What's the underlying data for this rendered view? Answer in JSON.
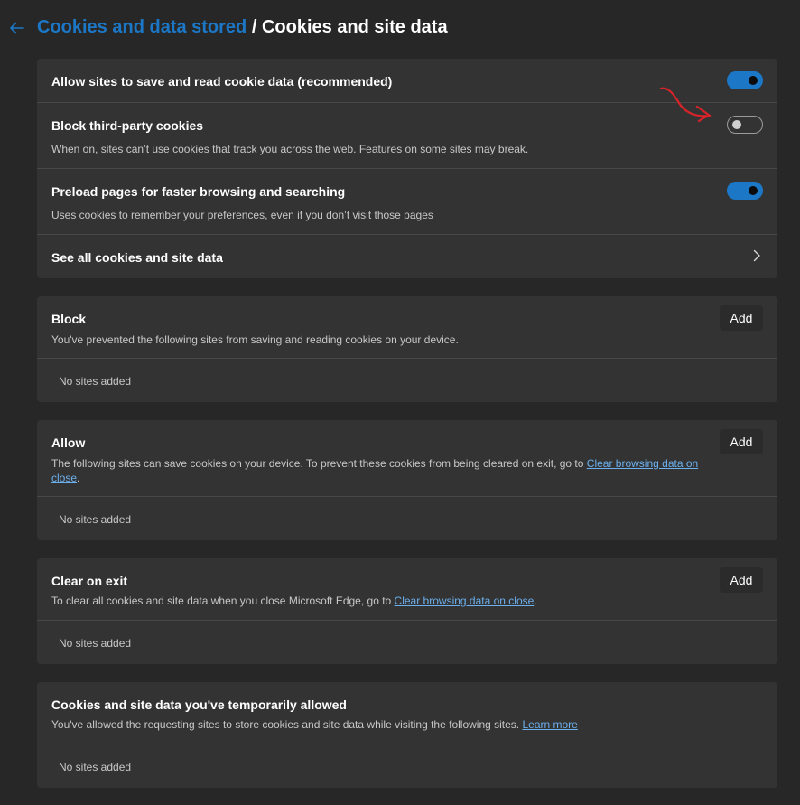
{
  "header": {
    "breadcrumb_parent": "Cookies and data stored",
    "separator": " / ",
    "breadcrumb_current": "Cookies and site data"
  },
  "settings": {
    "allow_sites": {
      "title": "Allow sites to save and read cookie data (recommended)",
      "enabled": true
    },
    "block_third_party": {
      "title": "Block third-party cookies",
      "description": "When on, sites can’t use cookies that track you across the web. Features on some sites may break.",
      "enabled": false
    },
    "preload": {
      "title": "Preload pages for faster browsing and searching",
      "description": "Uses cookies to remember your preferences, even if you don’t visit those pages",
      "enabled": true
    },
    "see_all": {
      "title": "See all cookies and site data"
    }
  },
  "block_section": {
    "title": "Block",
    "description": "You've prevented the following sites from saving and reading cookies on your device.",
    "add_label": "Add",
    "empty_text": "No sites added"
  },
  "allow_section": {
    "title": "Allow",
    "description_1": "The following sites can save cookies on your device. To prevent these cookies from being cleared on exit, go to ",
    "link_part_1": "Clear browsing data on",
    "link_part_2": "close",
    "description_end": ".",
    "add_label": "Add",
    "empty_text": "No sites added"
  },
  "clear_section": {
    "title": "Clear on exit",
    "description": "To clear all cookies and site data when you close Microsoft Edge, go to ",
    "link": "Clear browsing data on close",
    "description_end": ".",
    "add_label": "Add",
    "empty_text": "No sites added"
  },
  "temp_section": {
    "title": "Cookies and site data you've temporarily allowed",
    "description": "You've allowed the requesting sites to store cookies and site data while visiting the following sites. ",
    "link": "Learn more",
    "empty_text": "No sites added"
  },
  "colors": {
    "accent": "#1c78c7",
    "link": "#6cb0ee",
    "annotation": "#d9232b"
  }
}
